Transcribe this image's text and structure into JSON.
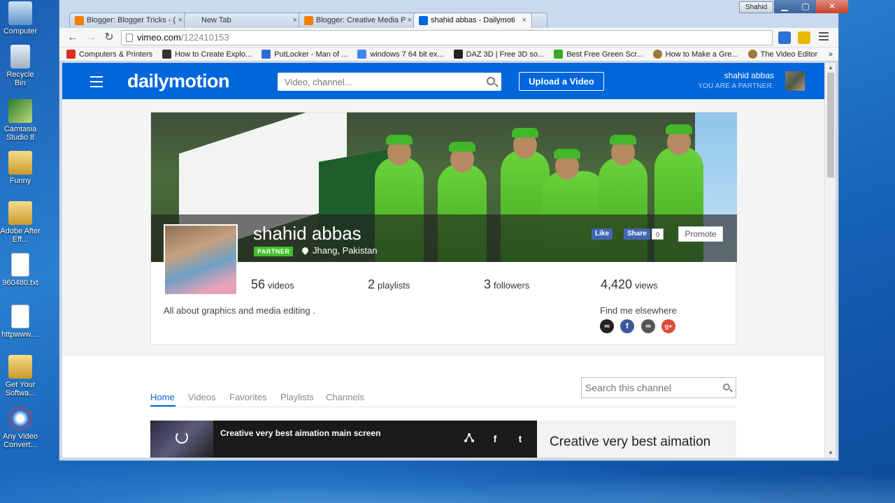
{
  "desktop": {
    "icons": [
      {
        "label": "Computer"
      },
      {
        "label": "Recycle Bin"
      },
      {
        "label": "Camtasia Studio 8"
      },
      {
        "label": "Funny"
      },
      {
        "label": "Adobe After Eff..."
      },
      {
        "label": "960480.txt"
      },
      {
        "label": "httpwww...."
      },
      {
        "label": "Get Your Softwa..."
      },
      {
        "label": "Any Video Convert..."
      }
    ]
  },
  "window": {
    "user_badge": "Shahid",
    "min_glyph": "▁",
    "max_glyph": "▢",
    "close_glyph": "✕"
  },
  "tabs": [
    {
      "title": "Blogger: Blogger Tricks - (",
      "close": "×"
    },
    {
      "title": "New Tab",
      "close": "×"
    },
    {
      "title": "Blogger: Creative Media P",
      "close": "×"
    },
    {
      "title": "shahid abbas - Dailymoti",
      "close": "×"
    }
  ],
  "toolbar": {
    "back": "←",
    "forward": "→",
    "reload": "↻",
    "url_host": "vimeo.com",
    "url_path": "/122410153"
  },
  "bookmarks": [
    {
      "label": "Computers & Printers",
      "color": "#d93025"
    },
    {
      "label": "How to Create Explo...",
      "color": "#333333"
    },
    {
      "label": "PutLocker - Man of ...",
      "color": "#2a6fd6"
    },
    {
      "label": "windows 7 64 bit ex...",
      "color": "#4285f4"
    },
    {
      "label": "DAZ 3D | Free 3D so...",
      "color": "#222222"
    },
    {
      "label": "Best Free Green Scr...",
      "color": "#3fa821"
    },
    {
      "label": "How to Make a Gre...",
      "color": "#9c7a3a"
    },
    {
      "label": "The Video Editor",
      "color": "#9c7a3a"
    }
  ],
  "bookmarks_more": "»",
  "dm": {
    "logo": "dailymotion",
    "search_placeholder": "Video, channel...",
    "upload_label": "Upload a Video",
    "user_name": "shahid abbas",
    "user_role": "YOU ARE A PARTNER."
  },
  "profile": {
    "name": "shahid abbas",
    "badge": "PARTNER",
    "location": "Jhang, Pakistan",
    "like_label": "Like",
    "share_label": "Share",
    "share_count": "0",
    "promote_label": "Promote",
    "stats": [
      {
        "num": "56",
        "label": "videos"
      },
      {
        "num": "2",
        "label": "playlists"
      },
      {
        "num": "3",
        "label": "followers"
      },
      {
        "num": "4,420",
        "label": "views"
      }
    ],
    "about": "All about graphics and media editing .",
    "elsewhere_label": "Find me elsewhere",
    "social": [
      {
        "name": "link",
        "color": "#222222",
        "glyph": "∞"
      },
      {
        "name": "facebook",
        "color": "#3b5998",
        "glyph": "f"
      },
      {
        "name": "link",
        "color": "#555555",
        "glyph": "∞"
      },
      {
        "name": "google-plus",
        "color": "#dd4b39",
        "glyph": "g+"
      }
    ]
  },
  "channel": {
    "tabs": [
      "Home",
      "Videos",
      "Favorites",
      "Playlists",
      "Channels"
    ],
    "active_tab": "Home",
    "search_placeholder": "Search this channel",
    "video_title": "Creative very best aimation main screen",
    "video_info_title": "Creative very best aimation",
    "f_glyph": "f",
    "t_glyph": "t"
  }
}
